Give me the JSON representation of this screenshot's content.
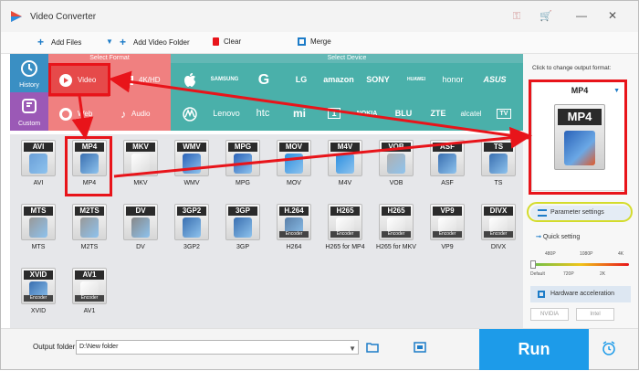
{
  "window": {
    "title": "Video Converter",
    "accent": "#1d9be9"
  },
  "toolbar": {
    "add_files": "Add Files",
    "add_video_folder": "Add Video Folder",
    "clear": "Clear",
    "merge": "Merge"
  },
  "categories": {
    "history": "History",
    "custom": "Custom",
    "select_format": "Select Format",
    "select_device": "Select Device",
    "format_tabs": [
      {
        "label": "Video",
        "icon": "play-icon"
      },
      {
        "label": "4K/HD",
        "icon": "monitor-icon"
      },
      {
        "label": "Web",
        "icon": "chrome-icon"
      },
      {
        "label": "Audio",
        "icon": "music-icon"
      }
    ],
    "devices_row1": [
      "",
      "SAMSUNG",
      "G",
      "LG",
      "amazon",
      "SONY",
      "HUAWEI",
      "honor",
      "ASUS"
    ],
    "devices_row2": [
      "",
      "Lenovo",
      "htc",
      "mi",
      "1",
      "NOKIA",
      "BLU",
      "ZTE",
      "alcatel",
      "TV"
    ]
  },
  "formats": [
    {
      "tag": "AVI",
      "name": "AVI",
      "color": "#6a9fd8",
      "enc": ""
    },
    {
      "tag": "MP4",
      "name": "MP4",
      "color": "#3a6fb0",
      "enc": ""
    },
    {
      "tag": "MKV",
      "name": "MKV",
      "color": "#ffffff",
      "enc": ""
    },
    {
      "tag": "WMV",
      "name": "WMV",
      "color": "#2a62b8",
      "enc": ""
    },
    {
      "tag": "MPG",
      "name": "MPG",
      "color": "#2a62b8",
      "enc": ""
    },
    {
      "tag": "MOV",
      "name": "MOV",
      "color": "#2b8fe0",
      "enc": ""
    },
    {
      "tag": "M4V",
      "name": "M4V",
      "color": "#2b8fe0",
      "enc": ""
    },
    {
      "tag": "VOB",
      "name": "VOB",
      "color": "#b0b0b0",
      "enc": ""
    },
    {
      "tag": "ASF",
      "name": "ASF",
      "color": "#3a6fb0",
      "enc": ""
    },
    {
      "tag": "TS",
      "name": "TS",
      "color": "#3a6fb0",
      "enc": ""
    },
    {
      "tag": "MTS",
      "name": "MTS",
      "color": "#999999",
      "enc": ""
    },
    {
      "tag": "M2TS",
      "name": "M2TS",
      "color": "#999999",
      "enc": ""
    },
    {
      "tag": "DV",
      "name": "DV",
      "color": "#888888",
      "enc": ""
    },
    {
      "tag": "3GP2",
      "name": "3GP2",
      "color": "#3a6fb0",
      "enc": ""
    },
    {
      "tag": "3GP",
      "name": "3GP",
      "color": "#3a6fb0",
      "enc": ""
    },
    {
      "tag": "H.264",
      "name": "H264",
      "color": "#5a7fa8",
      "enc": "Encoder"
    },
    {
      "tag": "H265",
      "name": "H265 for MP4",
      "color": "#ffffff",
      "enc": "Encoder"
    },
    {
      "tag": "H265",
      "name": "H265 for MKV",
      "color": "#ffffff",
      "enc": "Encoder"
    },
    {
      "tag": "VP9",
      "name": "VP9",
      "color": "#ffffff",
      "enc": "Encoder"
    },
    {
      "tag": "DIVX",
      "name": "DIVX",
      "color": "#ffffff",
      "enc": "Encoder"
    },
    {
      "tag": "XVID",
      "name": "XVID",
      "color": "#3a6fb0",
      "enc": "Encoder"
    },
    {
      "tag": "AV1",
      "name": "AV1",
      "color": "#ffffff",
      "enc": "Encoder"
    }
  ],
  "right": {
    "click_label": "Click to change output format:",
    "output_format": "MP4",
    "parameter_settings": "Parameter settings",
    "quick_setting": "Quick setting",
    "slider_top": [
      "480P",
      "1080P",
      "4K"
    ],
    "slider_bottom": [
      "Default",
      "720P",
      "2K"
    ],
    "hardware_accel": "Hardware acceleration",
    "nvidia": "NVIDIA",
    "intel": "Intel"
  },
  "bottom": {
    "output_folder_label": "Output folder:",
    "output_folder_value": "D:\\New folder",
    "run": "Run"
  }
}
